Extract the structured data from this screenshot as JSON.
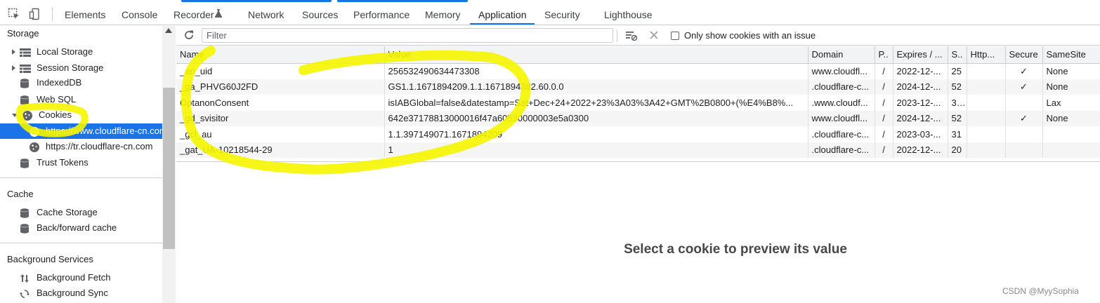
{
  "tabs": [
    {
      "label": "Elements"
    },
    {
      "label": "Console"
    },
    {
      "label": "Recorder"
    },
    {
      "label": "Network"
    },
    {
      "label": "Sources"
    },
    {
      "label": "Performance"
    },
    {
      "label": "Memory"
    },
    {
      "label": "Application",
      "active": true
    },
    {
      "label": "Security"
    },
    {
      "label": "Lighthouse"
    }
  ],
  "sidebar": {
    "storage_title": "Storage",
    "local_storage": "Local Storage",
    "session_storage": "Session Storage",
    "indexeddb": "IndexedDB",
    "web_sql": "Web SQL",
    "cookies": "Cookies",
    "cookie_origins": [
      "https://www.cloudflare-cn.com",
      "https://tr.cloudflare-cn.com"
    ],
    "trust_tokens": "Trust Tokens",
    "cache_title": "Cache",
    "cache_storage": "Cache Storage",
    "bfcache": "Back/forward cache",
    "bg_title": "Background Services",
    "bg_fetch": "Background Fetch",
    "bg_sync": "Background Sync"
  },
  "toolbar": {
    "filter_placeholder": "Filter",
    "only_issue_label": "Only show cookies with an issue"
  },
  "table": {
    "columns": [
      "Name",
      "Value",
      "Domain",
      "P..",
      "Expires / ...",
      "S..",
      "Http...",
      "Secure",
      "SameSite"
    ],
    "rows": [
      [
        "_an_uid",
        "256532490634473308",
        "www.cloudfl...",
        "/",
        "2022-12-...",
        "25",
        "",
        "✓",
        "None"
      ],
      [
        "_ga_PHVG60J2FD",
        "GS1.1.1671894209.1.1.1671894382.60.0.0",
        ".cloudflare-c...",
        "/",
        "2024-12-...",
        "52",
        "",
        "✓",
        "None"
      ],
      [
        "OptanonConsent",
        "isIABGlobal=false&datestamp=Sat+Dec+24+2022+23%3A03%3A42+GMT%2B0800+(%E4%B8%...",
        ".www.cloudf...",
        "/",
        "2023-12-...",
        "3...",
        "",
        "",
        "Lax"
      ],
      [
        "_gd_svisitor",
        "642e37178813000016f47a60530000003e5a0300",
        "www.cloudfl...",
        "/",
        "2024-12-...",
        "52",
        "",
        "✓",
        "None"
      ],
      [
        "_gcl_au",
        "1.1.397149071.1671894209",
        ".cloudflare-c...",
        "/",
        "2023-03-...",
        "31",
        "",
        "",
        ""
      ],
      [
        "_gat_UA-10218544-29",
        "1",
        ".cloudflare-c...",
        "/",
        "2022-12-...",
        "20",
        "",
        "",
        ""
      ]
    ]
  },
  "preview_text": "Select a cookie to preview its value",
  "watermark": "CSDN @MyySophia",
  "colors": {
    "accent": "#1a73e8",
    "highlighter": "#f5f500"
  }
}
